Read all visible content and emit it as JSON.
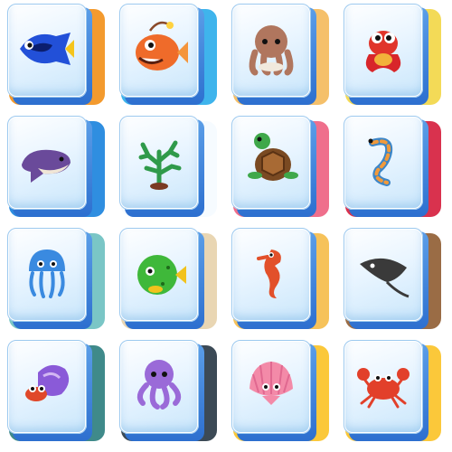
{
  "board": {
    "tiles": [
      {
        "icon": "blue-tang-fish-icon",
        "bg": "#f39a2e"
      },
      {
        "icon": "anglerfish-icon",
        "bg": "#3fb4ec"
      },
      {
        "icon": "octopus-brown-icon",
        "bg": "#f5c06a"
      },
      {
        "icon": "red-frog-fish-icon",
        "bg": "#f3da57"
      },
      {
        "icon": "whale-icon",
        "bg": "#2f8ee0"
      },
      {
        "icon": "coral-icon",
        "bg": "#f6fbff"
      },
      {
        "icon": "sea-turtle-icon",
        "bg": "#ef6f8c"
      },
      {
        "icon": "sea-worm-icon",
        "bg": "#d9324e"
      },
      {
        "icon": "jellyfish-icon",
        "bg": "#7ac6c6"
      },
      {
        "icon": "pufferfish-icon",
        "bg": "#e9d6b3"
      },
      {
        "icon": "seahorse-icon",
        "bg": "#f6c25a"
      },
      {
        "icon": "stingray-icon",
        "bg": "#9a6c45"
      },
      {
        "icon": "hermit-crab-icon",
        "bg": "#3f8a8a"
      },
      {
        "icon": "purple-octopus-icon",
        "bg": "#3c4a56"
      },
      {
        "icon": "seashell-icon",
        "bg": "#fbc83a"
      },
      {
        "icon": "crab-icon",
        "bg": "#fbc83a"
      }
    ]
  }
}
